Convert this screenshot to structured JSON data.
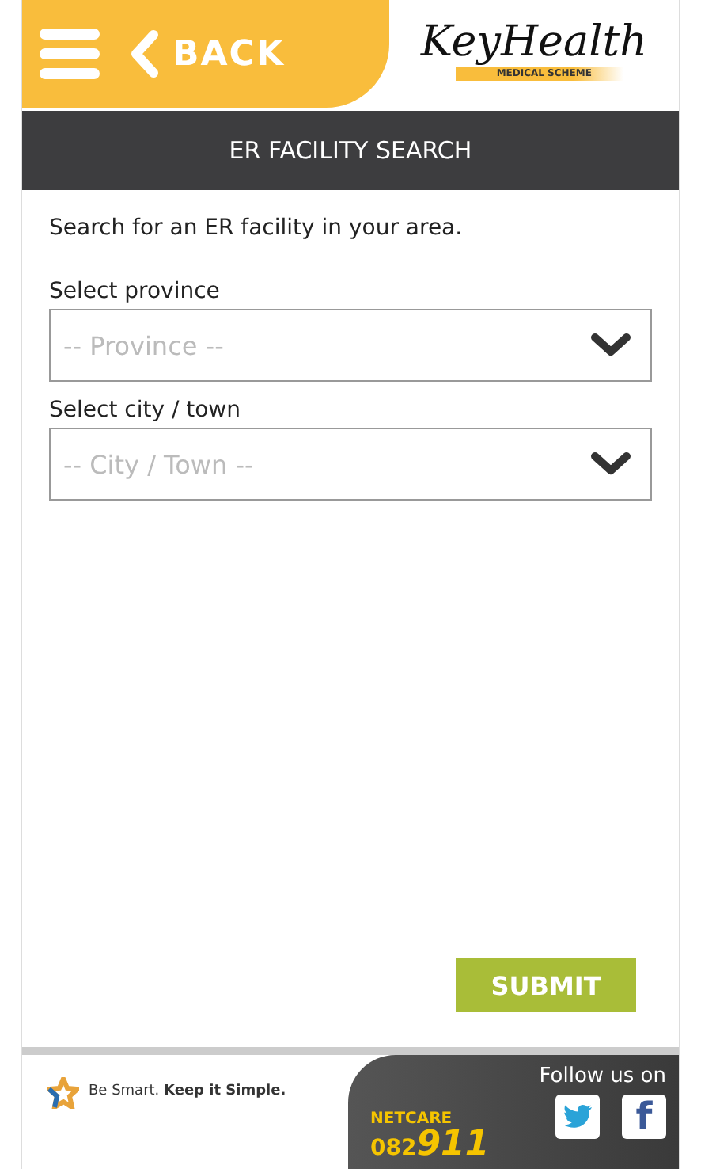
{
  "header": {
    "back_label": "BACK",
    "logo": {
      "name": "KeyHealth",
      "tagline": "MEDICAL SCHEME"
    }
  },
  "title_bar": {
    "title": "ER FACILITY SEARCH"
  },
  "form": {
    "intro": "Search for an ER facility in your area.",
    "fields": [
      {
        "label": "Select province",
        "placeholder": "-- Province --"
      },
      {
        "label": "Select city / town",
        "placeholder": "-- City / Town --"
      }
    ],
    "submit": "SUBMIT"
  },
  "footer": {
    "tagline": "Be Smart. **Keep it Simple.**",
    "netcare": {
      "brand": "NETCARE",
      "number": "082",
      "number_big": "911"
    },
    "follow_label": "Follow us on",
    "social": [
      {
        "kind": "twitter"
      },
      {
        "kind": "facebook",
        "label": "f"
      }
    ]
  }
}
